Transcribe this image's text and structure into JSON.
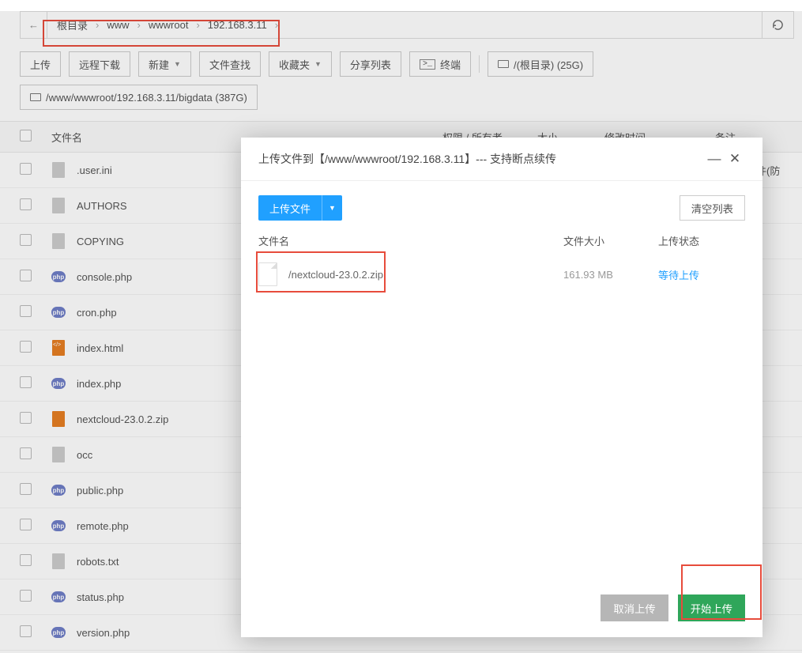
{
  "breadcrumb": {
    "back_icon": "←",
    "segments": [
      "根目录",
      "www",
      "wwwroot",
      "192.168.3.11"
    ],
    "refresh_icon": "refresh"
  },
  "toolbar": {
    "upload": "上传",
    "remote_download": "远程下载",
    "new": "新建",
    "search": "文件查找",
    "favorites": "收藏夹",
    "share": "分享列表",
    "terminal": "终端",
    "terminal_icon": ">_",
    "disk1": "/(根目录) (25G)",
    "disk2": "/www/wwwroot/192.168.3.11/bigdata (387G)"
  },
  "columns": {
    "name": "文件名",
    "perm": "权限 / 所有者",
    "size": "大小",
    "time": "修改时间",
    "note": "备注"
  },
  "files": [
    {
      "name": ".user.ini",
      "icon": "doc",
      "note": "中配置文件(防"
    },
    {
      "name": "AUTHORS",
      "icon": "doc"
    },
    {
      "name": "COPYING",
      "icon": "doc"
    },
    {
      "name": "console.php",
      "icon": "php"
    },
    {
      "name": "cron.php",
      "icon": "php"
    },
    {
      "name": "index.html",
      "icon": "html"
    },
    {
      "name": "index.php",
      "icon": "php"
    },
    {
      "name": "nextcloud-23.0.2.zip",
      "icon": "zip"
    },
    {
      "name": "occ",
      "icon": "doc"
    },
    {
      "name": "public.php",
      "icon": "php"
    },
    {
      "name": "remote.php",
      "icon": "php"
    },
    {
      "name": "robots.txt",
      "icon": "doc"
    },
    {
      "name": "status.php",
      "icon": "php"
    },
    {
      "name": "version.php",
      "icon": "php"
    }
  ],
  "modal": {
    "title": "上传文件到【/www/wwwroot/192.168.3.11】--- 支持断点续传",
    "upload_btn": "上传文件",
    "clear_btn": "清空列表",
    "cols": {
      "name": "文件名",
      "size": "文件大小",
      "status": "上传状态"
    },
    "rows": [
      {
        "name": "/nextcloud-23.0.2.zip",
        "size": "161.93 MB",
        "status": "等待上传"
      }
    ],
    "cancel": "取消上传",
    "start": "开始上传"
  }
}
